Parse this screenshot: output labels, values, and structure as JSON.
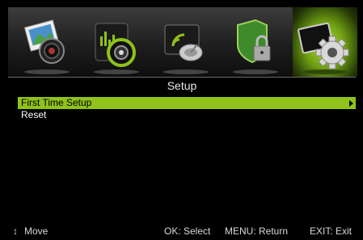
{
  "tabs": [
    {
      "name": "picture",
      "icon": "picture-icon"
    },
    {
      "name": "sound",
      "icon": "sound-icon"
    },
    {
      "name": "channel",
      "icon": "satellite-dish-icon"
    },
    {
      "name": "lock",
      "icon": "lock-icon"
    },
    {
      "name": "setup",
      "icon": "gear-icon",
      "active": true
    }
  ],
  "title": "Setup",
  "menu": [
    {
      "label": "First Time Setup",
      "selected": true
    },
    {
      "label": "Reset",
      "selected": false
    }
  ],
  "footer": {
    "move_symbol": "↕",
    "move": "Move",
    "select": "OK: Select",
    "return": "MENU: Return",
    "exit": "EXIT: Exit"
  },
  "colors": {
    "highlight": "#8fc21a",
    "background": "#000000"
  }
}
